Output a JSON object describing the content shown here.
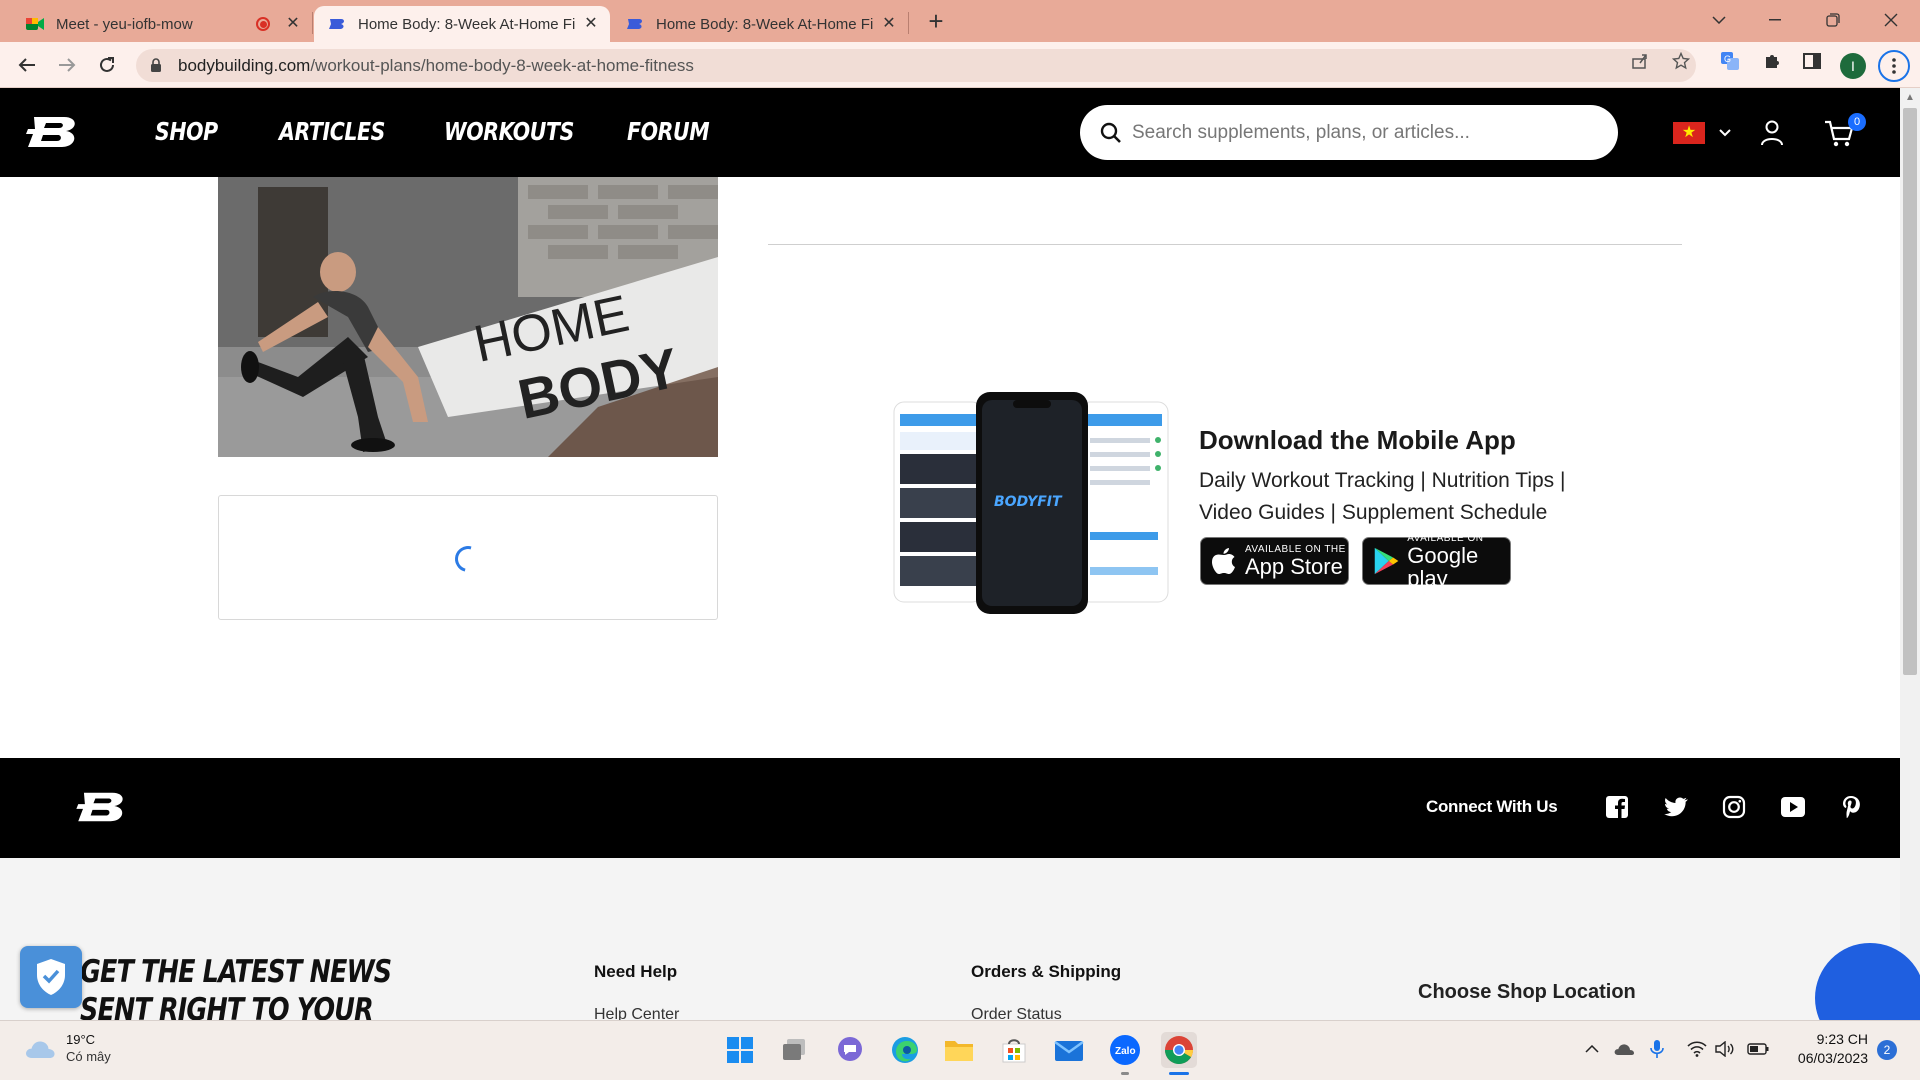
{
  "browser": {
    "tabs": [
      {
        "title": "Meet - yeu-iofb-mow",
        "recording": true
      },
      {
        "title": "Home Body: 8-Week At-Home Fi",
        "active": true
      },
      {
        "title": "Home Body: 8-Week At-Home Fi"
      }
    ],
    "url_host": "bodybuilding.com",
    "url_path": "/workout-plans/home-body-8-week-at-home-fitness",
    "profile_initial": "I"
  },
  "site": {
    "nav": [
      "SHOP",
      "ARTICLES",
      "WORKOUTS",
      "FORUM"
    ],
    "search_placeholder": "Search supplements, plans, or articles...",
    "cart_count": "0",
    "flag": "vietnam-flag"
  },
  "hero": {
    "line1": "HOME",
    "line2": "BODY"
  },
  "app_promo": {
    "title": "Download the Mobile App",
    "description": "Daily Workout Tracking | Nutrition Tips | Video Guides | Supplement Schedule",
    "phone_brand": "BODYFIT",
    "app_store_small": "AVAILABLE ON THE",
    "app_store_big": "App Store",
    "google_small": "AVAILABLE ON",
    "google_big": "Google play"
  },
  "footer": {
    "connect": "Connect With Us",
    "social": [
      "facebook-icon",
      "twitter-icon",
      "instagram-icon",
      "youtube-icon",
      "pinterest-icon"
    ],
    "newsletter": "GET THE LATEST NEWS SENT RIGHT TO YOUR INBOX!",
    "col1_title": "Need Help",
    "col1_link": "Help Center",
    "col2_title": "Orders & Shipping",
    "col2_link": "Order Status",
    "shop_location": "Choose Shop Location"
  },
  "taskbar": {
    "temp": "19°C",
    "weather": "Có mây",
    "time": "9:23 CH",
    "date": "06/03/2023",
    "notifications": "2",
    "zalo": "Zalo"
  },
  "colors": {
    "tabbar": "#e8aa98",
    "header": "#000000",
    "accent": "#1a6dff"
  }
}
